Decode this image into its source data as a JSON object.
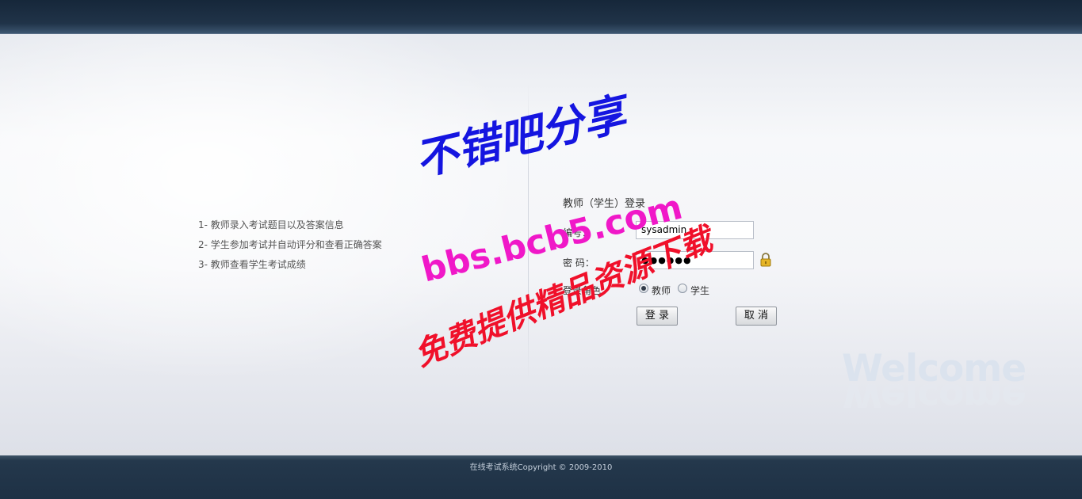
{
  "features": [
    "1- 教师录入考试题目以及答案信息",
    "2- 学生参加考试并自动评分和查看正确答案",
    "3- 教师查看学生考试成绩"
  ],
  "login": {
    "title": "教师（学生）登录",
    "id_label": "编号：",
    "id_value": "sysadmin",
    "password_label": "密 码：",
    "password_value": "●●●●●●",
    "role_label": "登录角色：",
    "roles": [
      {
        "label": "教师",
        "selected": true
      },
      {
        "label": "学生",
        "selected": false
      }
    ],
    "login_button": "登 录",
    "cancel_button": "取 消"
  },
  "welcome_text": "Welcome",
  "footer": {
    "copyright": "在线考试系统Copyright © 2009-2010"
  },
  "watermark": {
    "line1": "不错吧分享",
    "line2": "bbs.bcb5.com",
    "line3": "免费提供精品资源下载"
  },
  "colors": {
    "header_bg": "#1e3145",
    "footer_bg": "#1e3145",
    "watermark_blue": "#1515e0",
    "watermark_magenta": "#f018c8",
    "watermark_red": "#f0102a"
  }
}
